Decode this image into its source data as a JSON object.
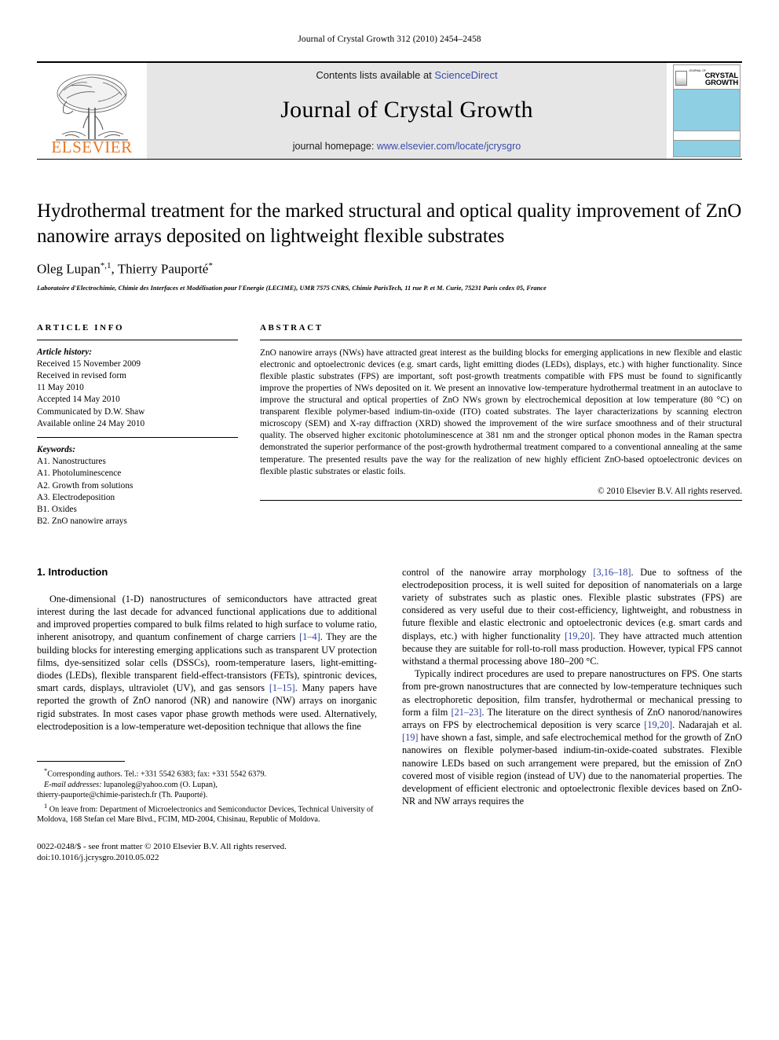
{
  "running_head": "Journal of Crystal Growth 312 (2010) 2454–2458",
  "masthead": {
    "logo_wordmark": "ELSEVIER",
    "contents_prefix": "Contents lists available at ",
    "sciencedirect": "ScienceDirect",
    "journal_title": "Journal of Crystal Growth",
    "homepage_prefix": "journal homepage: ",
    "homepage_url": "www.elsevier.com/locate/jcrysgro",
    "cover": {
      "line1": "CRYSTAL",
      "line2": "GROWTH",
      "tiny": "JOURNAL OF",
      "band_color": "#8ecfe3"
    },
    "logo_color": "#e87722",
    "link_color": "#3b4ba8"
  },
  "title_block": {
    "title": "Hydrothermal treatment for the marked structural and optical quality improvement of ZnO nanowire arrays deposited on lightweight flexible substrates",
    "author1": "Oleg Lupan",
    "author1_marks": "*,1",
    "author_sep": ", ",
    "author2": "Thierry Pauporté",
    "author2_marks": "*",
    "affiliation": "Laboratoire d'Electrochimie, Chimie des Interfaces et Modélisation pour l'Energie (LECIME), UMR 7575 CNRS, Chimie ParisTech, 11 rue P. et M. Curie, 75231 Paris cedex 05, France"
  },
  "article_info": {
    "label": "ARTICLE INFO",
    "history_label": "Article history:",
    "history": [
      "Received 15 November 2009",
      "Received in revised form",
      "11 May 2010",
      "Accepted 14 May 2010",
      "Communicated by D.W. Shaw",
      "Available online 24 May 2010"
    ],
    "keywords_label": "Keywords:",
    "keywords": [
      "A1. Nanostructures",
      "A1. Photoluminescence",
      "A2. Growth from solutions",
      "A3. Electrodeposition",
      "B1. Oxides",
      "B2. ZnO nanowire arrays"
    ]
  },
  "abstract": {
    "label": "ABSTRACT",
    "text": "ZnO nanowire arrays (NWs) have attracted great interest as the building blocks for emerging applications in new flexible and elastic electronic and optoelectronic devices (e.g. smart cards, light emitting diodes (LEDs), displays, etc.) with higher functionality. Since flexible plastic substrates (FPS) are important, soft post-growth treatments compatible with FPS must be found to significantly improve the properties of NWs deposited on it. We present an innovative low-temperature hydrothermal treatment in an autoclave to improve the structural and optical properties of ZnO NWs grown by electrochemical deposition at low temperature (80 °C) on transparent flexible polymer-based indium-tin-oxide (ITO) coated substrates. The layer characterizations by scanning electron microscopy (SEM) and X-ray diffraction (XRD) showed the improvement of the wire surface smoothness and of their structural quality. The observed higher excitonic photoluminescence at 381 nm and the stronger optical phonon modes in the Raman spectra demonstrated the superior performance of the post-growth hydrothermal treatment compared to a conventional annealing at the same temperature. The presented results pave the way for the realization of new highly efficient ZnO-based optoelectronic devices on flexible plastic substrates or elastic foils.",
    "copyright": "© 2010 Elsevier B.V. All rights reserved."
  },
  "introduction": {
    "heading": "1. Introduction",
    "left_para_a": "One-dimensional (1-D) nanostructures of semiconductors have attracted great interest during the last decade for advanced functional applications due to additional and improved properties compared to bulk films related to high surface to volume ratio, inherent anisotropy, and quantum confinement of charge carriers ",
    "cite_1_4": "[1–4]",
    "left_para_b": ". They are the building blocks for interesting emerging applications such as transparent UV protection films, dye-sensitized solar cells (DSSCs), room-temperature lasers, light-emitting-diodes (LEDs), flexible transparent field-effect-transistors (FETs), spintronic devices, smart cards, displays, ultraviolet (UV), and gas sensors ",
    "cite_1_15": "[1–15]",
    "left_para_c": ". Many papers have reported the growth of ZnO nanorod (NR) and nanowire (NW) arrays on inorganic rigid substrates. In most cases vapor phase growth methods were used. Alternatively, electrodeposition is a low-temperature wet-deposition technique that allows the fine",
    "right_para_a": "control of the nanowire array morphology ",
    "cite_3_16_18": "[3,16–18]",
    "right_para_b": ". Due to softness of the electrodeposition process, it is well suited for deposition of nanomaterials on a large variety of substrates such as plastic ones. Flexible plastic substrates (FPS) are considered as very useful due to their cost-efficiency, lightweight, and robustness in future flexible and elastic electronic and optoelectronic devices (e.g. smart cards and displays, etc.) with higher functionality ",
    "cite_19_20_a": "[19,20]",
    "right_para_c": ". They have attracted much attention because they are suitable for roll-to-roll mass production. However, typical FPS cannot withstand a thermal processing above 180–200 °C.",
    "right_para_d": "Typically indirect procedures are used to prepare nanostructures on FPS. One starts from pre-grown nanostructures that are connected by low-temperature techniques such as electrophoretic deposition, film transfer, hydrothermal or mechanical pressing to form a film ",
    "cite_21_23": "[21–23]",
    "right_para_e": ". The literature on the direct synthesis of ZnO nanorod/nanowires arrays on FPS by electrochemical deposition is very scarce ",
    "cite_19_20_b": "[19,20]",
    "right_para_f": ". Nadarajah et al. ",
    "cite_19": "[19]",
    "right_para_g": " have shown a fast, simple, and safe electrochemical method for the growth of ZnO nanowires on flexible polymer-based indium-tin-oxide-coated substrates. Flexible nanowire LEDs based on such arrangement were prepared, but the emission of ZnO covered most of visible region (instead of UV) due to the nanomaterial properties. The development of efficient electronic and optoelectronic flexible devices based on ZnO-NR and NW arrays requires the"
  },
  "footnotes": {
    "corresponding": "Corresponding authors. Tel.: +331 5542 6383; fax: +331 5542 6379.",
    "email_label": "E-mail addresses:",
    "email1": " lupanoleg@yahoo.com (O. Lupan),",
    "email2": "thierry-pauporte@chimie-paristech.fr (Th. Pauporté).",
    "note1_marker": "1",
    "note1": " On leave from: Department of Microelectronics and Semiconductor Devices, Technical University of Moldova, 168 Stefan cel Mare Blvd., FCIM, MD-2004, Chisinau, Republic of Moldova.",
    "issn_line": "0022-0248/$ - see front matter © 2010 Elsevier B.V. All rights reserved.",
    "doi_line": "doi:10.1016/j.jcrysgro.2010.05.022"
  }
}
